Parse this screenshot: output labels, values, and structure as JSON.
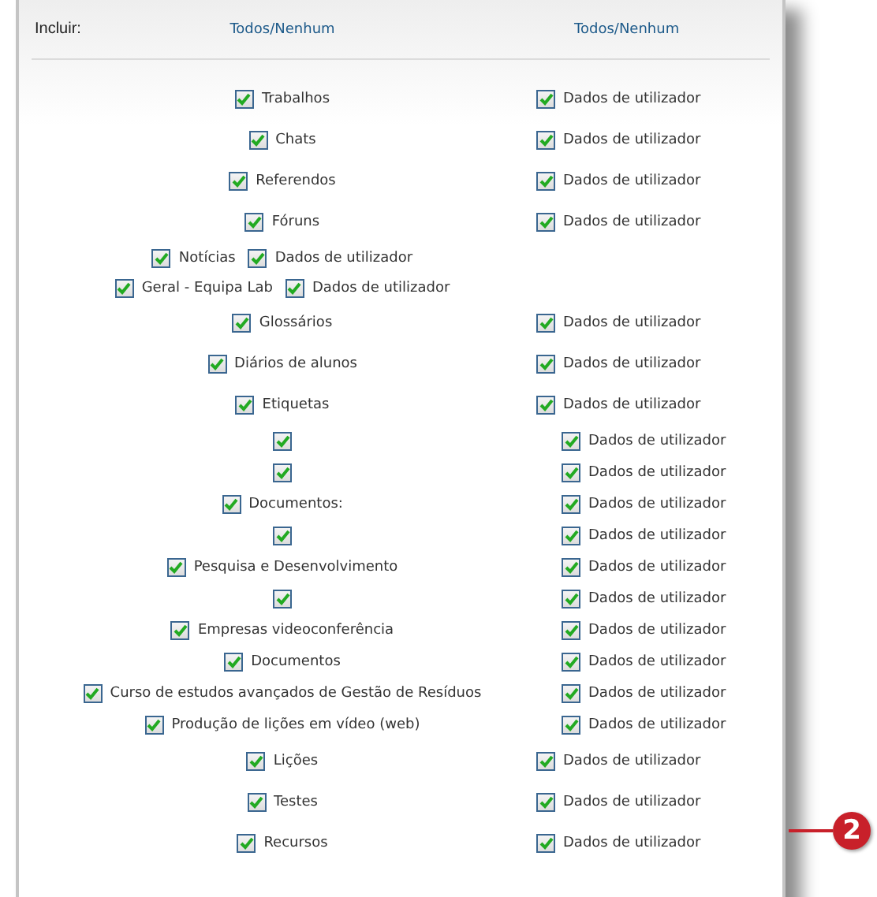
{
  "header": {
    "label": "Incluir:",
    "columns": [
      {
        "all": "Todos",
        "separator": "/",
        "none": "Nenhum"
      },
      {
        "all": "Todos",
        "separator": "/",
        "none": "Nenhum"
      }
    ]
  },
  "rows": [
    {
      "kind": "spaced",
      "items": [
        {
          "label": "Trabalhos",
          "checked": true
        },
        {
          "label": "Dados de utilizador",
          "checked": true
        }
      ]
    },
    {
      "kind": "spaced",
      "items": [
        {
          "label": "Chats",
          "checked": true
        },
        {
          "label": "Dados de utilizador",
          "checked": true
        }
      ]
    },
    {
      "kind": "spaced",
      "items": [
        {
          "label": "Referendos",
          "checked": true
        },
        {
          "label": "Dados de utilizador",
          "checked": true
        }
      ]
    },
    {
      "kind": "spaced",
      "items": [
        {
          "label": "Fóruns",
          "checked": true
        },
        {
          "label": "Dados de utilizador",
          "checked": true
        }
      ]
    },
    {
      "kind": "inline",
      "items": [
        {
          "label": "Notícias",
          "checked": true
        },
        {
          "label": "Dados de utilizador",
          "checked": true
        }
      ]
    },
    {
      "kind": "inline",
      "items": [
        {
          "label": "Geral - Equipa Lab",
          "checked": true
        },
        {
          "label": "Dados de utilizador",
          "checked": true
        }
      ]
    },
    {
      "kind": "spaced",
      "items": [
        {
          "label": "Glossários",
          "checked": true
        },
        {
          "label": "Dados de utilizador",
          "checked": true
        }
      ]
    },
    {
      "kind": "spaced",
      "items": [
        {
          "label": "Diários de alunos",
          "checked": true
        },
        {
          "label": "Dados de utilizador",
          "checked": true
        }
      ]
    },
    {
      "kind": "spaced",
      "items": [
        {
          "label": "Etiquetas",
          "checked": true
        },
        {
          "label": "Dados de utilizador",
          "checked": true
        }
      ]
    },
    {
      "kind": "compact",
      "items": [
        {
          "checked": true
        },
        {
          "label": "Dados de utilizador",
          "checked": true
        }
      ]
    },
    {
      "kind": "compact",
      "items": [
        {
          "checked": true
        },
        {
          "label": "Dados de utilizador",
          "checked": true
        }
      ]
    },
    {
      "kind": "compact",
      "items": [
        {
          "label": "Documentos:",
          "checked": true
        },
        {
          "label": "Dados de utilizador",
          "checked": true
        }
      ]
    },
    {
      "kind": "compact",
      "items": [
        {
          "checked": true
        },
        {
          "label": "Dados de utilizador",
          "checked": true
        }
      ]
    },
    {
      "kind": "compact",
      "items": [
        {
          "label": "Pesquisa e Desenvolvimento",
          "checked": true
        },
        {
          "label": "Dados de utilizador",
          "checked": true
        }
      ]
    },
    {
      "kind": "compact",
      "items": [
        {
          "checked": true
        },
        {
          "label": "Dados de utilizador",
          "checked": true
        }
      ]
    },
    {
      "kind": "compact",
      "items": [
        {
          "label": "Empresas videoconferência",
          "checked": true
        },
        {
          "label": "Dados de utilizador",
          "checked": true
        }
      ]
    },
    {
      "kind": "compact",
      "items": [
        {
          "label": "Documentos",
          "checked": true
        },
        {
          "label": "Dados de utilizador",
          "checked": true
        }
      ]
    },
    {
      "kind": "compact",
      "items": [
        {
          "label": "Curso de estudos avançados de Gestão de Resíduos",
          "checked": true
        },
        {
          "label": "Dados de utilizador",
          "checked": true
        }
      ]
    },
    {
      "kind": "compact",
      "items": [
        {
          "label": "Produção de lições em vídeo (web)",
          "checked": true
        },
        {
          "label": "Dados de utilizador",
          "checked": true
        }
      ]
    },
    {
      "kind": "spaced",
      "items": [
        {
          "label": "Lições",
          "checked": true
        },
        {
          "label": "Dados de utilizador",
          "checked": true
        }
      ]
    },
    {
      "kind": "spaced",
      "items": [
        {
          "label": "Testes",
          "checked": true
        },
        {
          "label": "Dados de utilizador",
          "checked": true
        }
      ]
    },
    {
      "kind": "spaced",
      "items": [
        {
          "label": "Recursos",
          "checked": true
        },
        {
          "label": "Dados de utilizador",
          "checked": true
        }
      ]
    }
  ],
  "callout": {
    "label": "2"
  }
}
